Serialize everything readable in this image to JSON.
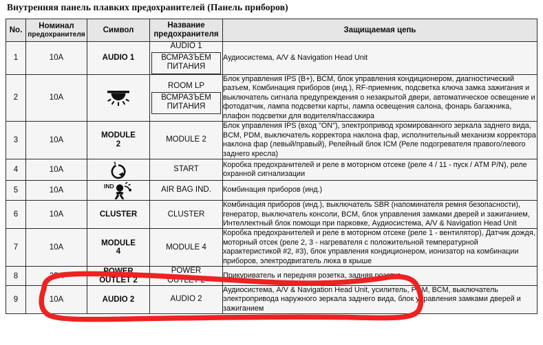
{
  "document": {
    "title": "Внутренняя панель плавких предохранителей (Панель приборов)"
  },
  "table": {
    "headers": {
      "no": "No.",
      "rating_line1": "Номинал",
      "rating_line2": "предохранителя",
      "symbol": "Символ",
      "name_line1": "Название",
      "name_line2": "предохранителя",
      "circuit": "Защищаемая цепь"
    },
    "rows": [
      {
        "no": "1",
        "rating": "10A",
        "symbol_text": "AUDIO 1",
        "symbol_icon": "",
        "name_top": "AUDIO 1",
        "name_box_line1": "ВСМРАЗЪЕМ",
        "name_box_line2": "ПИТАНИЯ",
        "circuit": "Аудиосистема, A/V & Navigation Head Unit"
      },
      {
        "no": "2",
        "rating": "10A",
        "symbol_text": "",
        "symbol_icon": "dome-lamp-icon",
        "name_top": "ROOM LP",
        "name_box_line1": "ВСМРАЗЪЕМ",
        "name_box_line2": "ПИТАНИЯ",
        "circuit": "Блок управления IPS (B+), BCM, блок управления кондиционером, диагностический разъем, Комбинация приборов (инд.), RF-приемник, подсветка ключа замка зажигания и выключатель сигнала предупреждения о незакрытой двери, автоматическое освещение и фотодатчик, лампа подсветки карты, лампа освещения салона, фонарь багажника, плафон подсветки для водителя/пассажира"
      },
      {
        "no": "3",
        "rating": "10A",
        "symbol_text": "MODULE\n2",
        "symbol_line1": "MODULE",
        "symbol_line2": "2",
        "symbol_icon": "",
        "name_top": "MODULE 2",
        "name_box_line1": "",
        "name_box_line2": "",
        "circuit": "Блок управления IPS (вход \"ON\"), электропривод хромированного зеркала заднего вида, BCM, PDM, выключатель корректора наклона фар, исполнительный механизм корректора наклона фар (левый/правый), Релейный блок ICM (Реле подогревателя правого/левого заднего кресла)"
      },
      {
        "no": "4",
        "rating": "10A",
        "symbol_text": "",
        "symbol_icon": "ignition-start-icon",
        "symbol_icon_sup": "1",
        "name_top": "START",
        "name_box_line1": "",
        "name_box_line2": "",
        "circuit": "Коробка предохранителей и реле в моторном отсеке (реле 4 / 11 - пуск / ATM P/N), реле охранной сигнализации"
      },
      {
        "no": "5",
        "rating": "10A",
        "symbol_text": "",
        "symbol_icon": "air-bag-icon",
        "symbol_icon_label": "IND",
        "name_top": "AIR BAG IND.",
        "name_box_line1": "",
        "name_box_line2": "",
        "circuit": "Комбинация приборов (инд.)"
      },
      {
        "no": "6",
        "rating": "10A",
        "symbol_text": "CLUSTER",
        "symbol_icon": "",
        "name_top": "CLUSTER",
        "name_box_line1": "",
        "name_box_line2": "",
        "circuit": "Комбинация приборов (инд.), выключатель SBR (напоминателя ремня безопасности), генератор, выключатель консоли, BCM, блок управления замками дверей и зажиганием, Интеллектный блок помощи при парковке, Аудиосистема, A/V & Navigation Head Unit"
      },
      {
        "no": "7",
        "rating": "10A",
        "symbol_text": "MODULE\n4",
        "symbol_line1": "MODULE",
        "symbol_line2": "4",
        "symbol_icon": "",
        "name_top": "MODULE 4",
        "name_box_line1": "",
        "name_box_line2": "",
        "circuit": "Коробка предохранителей и реле в моторном отсеке (реле 1 - вентилятор), Датчик дождя, моторный отсек (реле 2, 3 - нагревателя с положительной температурной характеристикой #2, #3), блок управления кондиционером, ионизатор на комбинации приборов, электродвигатель люка в крыше"
      },
      {
        "no": "8",
        "rating": "25A",
        "symbol_text": "POWER\nOUTLET 2",
        "symbol_line1": "POWER",
        "symbol_line2": "OUTLET 2",
        "symbol_icon": "",
        "name_top": "POWER",
        "name_top2": "OUTLET 2",
        "name_box_line1": "",
        "name_box_line2": "",
        "circuit": "Прикуриватель и передняя розетка, задняя розетка",
        "highlighted": true
      },
      {
        "no": "9",
        "rating": "10A",
        "symbol_text": "AUDIO 2",
        "symbol_icon": "",
        "name_top": "AUDIO 2",
        "name_box_line1": "",
        "name_box_line2": "",
        "circuit": "Аудиосистема, A/V & Navigation Head Unit, усилитель, PDM, BCM, выключатель электропривода наружного зеркала заднего вида, блок управления замками дверей и зажиганием"
      }
    ]
  },
  "annotation": {
    "type": "hand-drawn-oval",
    "color": "#ee2222",
    "target_row": "8"
  }
}
